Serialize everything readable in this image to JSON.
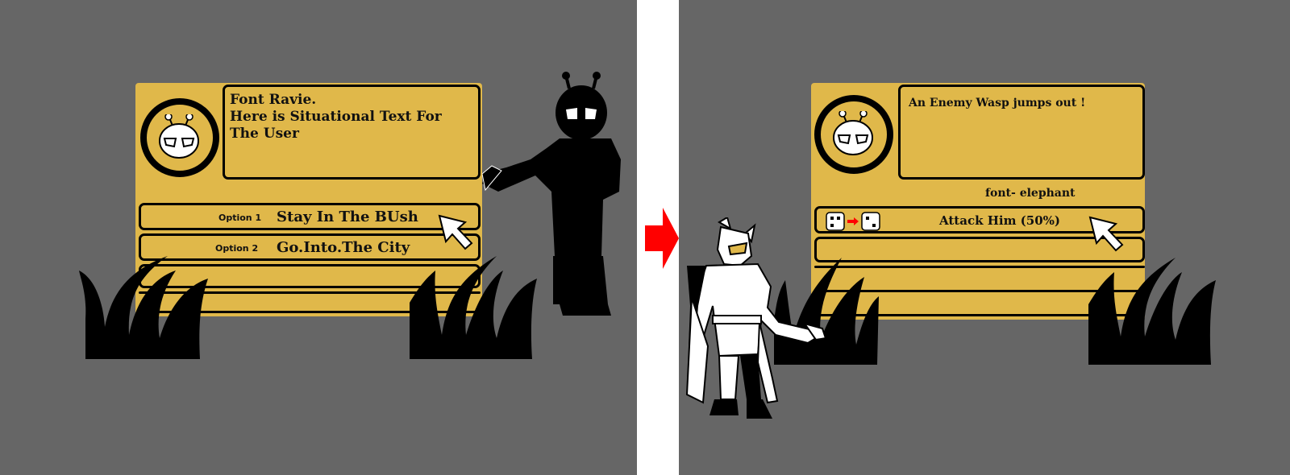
{
  "left": {
    "situational_text_line1": "Font Ravie.",
    "situational_text_line2": "Here is Situational Text For The User",
    "options": [
      {
        "number": "Option 1",
        "label": "Stay In The BUsh"
      },
      {
        "number": "Option 2",
        "label": "Go.Into.The City"
      }
    ]
  },
  "right": {
    "situational_text": "An Enemy Wasp jumps out !",
    "font_note": "font- elephant",
    "options": [
      {
        "label": "Attack Him (50%)"
      }
    ]
  },
  "colors": {
    "background": "#666666",
    "card": "#e0b84a",
    "outline": "#000000",
    "arrow": "#ff0000"
  },
  "icons": [
    "bug-portrait-icon",
    "cursor-arrow-icon",
    "dice-icon",
    "red-arrow-icon",
    "grass-bush-icon"
  ]
}
